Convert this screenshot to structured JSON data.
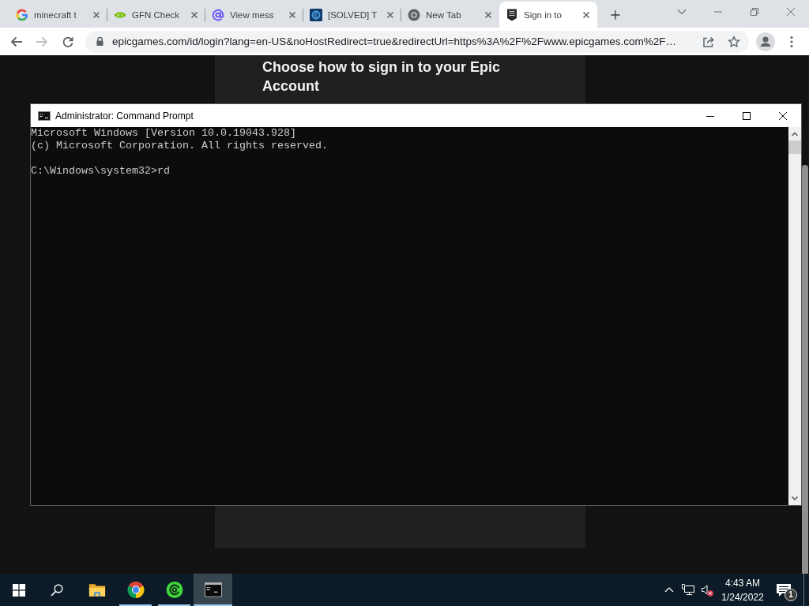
{
  "browser": {
    "tabs": [
      {
        "title": "minecraft t",
        "kind": "search",
        "selected": false
      },
      {
        "title": "GFN Check",
        "kind": "stream",
        "selected": false
      },
      {
        "title": "View mess",
        "kind": "mail",
        "selected": false
      },
      {
        "title": "[SOLVED] T",
        "kind": "forum",
        "selected": false
      },
      {
        "title": "New Tab",
        "kind": "newtab",
        "selected": false
      },
      {
        "title": "Sign in to",
        "kind": "store",
        "selected": true
      }
    ],
    "back_button": {
      "disabled": false
    },
    "forward_button": {
      "disabled": true
    },
    "url": "epicgames.com/id/login?lang=en-US&noHostRedirect=true&redirectUrl=https%3A%2F%2Fwww.epicgames.com%2F…"
  },
  "page": {
    "heading": "Choose how to sign in to your Epic Account"
  },
  "console_window": {
    "title": "Administrator: Command Prompt",
    "output": [
      "Microsoft Windows [Version 10.0.19043.928]",
      "(c) Microsoft Corporation. All rights reserved."
    ],
    "prompt": "C:\\Windows\\system32>rd"
  },
  "taskbar": {
    "apps": [
      {
        "kind": "files",
        "running": false,
        "selected": false
      },
      {
        "kind": "browser",
        "running": true,
        "selected": false
      },
      {
        "kind": "app",
        "running": true,
        "selected": false
      },
      {
        "kind": "console",
        "running": true,
        "selected": true
      }
    ],
    "tray": {
      "muted": true,
      "time": "4:43 AM",
      "date": "1/24/2022",
      "notifications": "1"
    }
  }
}
